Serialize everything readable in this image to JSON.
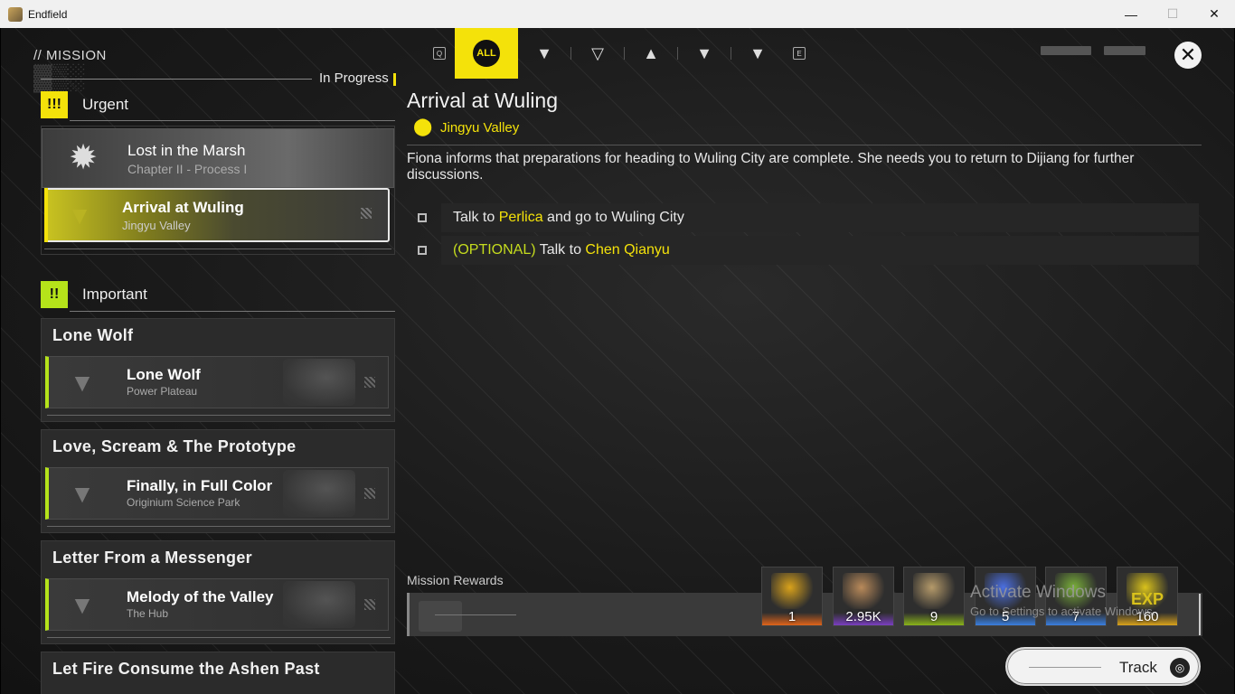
{
  "window": {
    "title": "Endfield",
    "controls": {
      "minimize": "—",
      "maximize": "☐",
      "close": "✕"
    }
  },
  "header": {
    "section_title": "// MISSION",
    "filter_keys": {
      "left": "Q",
      "right": "E"
    },
    "active_filter": "ALL",
    "close_glyph": "✕"
  },
  "filters": [
    {
      "name": "all",
      "label": "ALL",
      "active": true
    },
    {
      "name": "filter-1",
      "glyph": "▼"
    },
    {
      "name": "filter-2",
      "glyph": "▽"
    },
    {
      "name": "filter-3",
      "glyph": "▲"
    },
    {
      "name": "filter-4",
      "glyph": "▼"
    },
    {
      "name": "filter-5",
      "glyph": "▼"
    }
  ],
  "status_header": "In Progress",
  "sections": {
    "urgent": {
      "label": "Urgent",
      "icon_text": "!!!",
      "color": "#f4e20a"
    },
    "important": {
      "label": "Important",
      "icon_text": "!!",
      "color": "#b5e31a"
    }
  },
  "urgent_missions": {
    "featured": {
      "title": "Lost in the Marsh",
      "subtitle": "Chapter II - Process I"
    },
    "selected": {
      "name": "Arrival at Wuling",
      "location": "Jingyu Valley"
    }
  },
  "important_missions": [
    {
      "group": "Lone Wolf",
      "name": "Lone Wolf",
      "location": "Power Plateau"
    },
    {
      "group": "Love, Scream & The Prototype",
      "name": "Finally, in Full Color",
      "location": "Originium Science Park"
    },
    {
      "group": "Letter From a Messenger",
      "name": "Melody of the Valley",
      "location": "The Hub"
    },
    {
      "group": "Let Fire Consume the Ashen Past"
    }
  ],
  "detail": {
    "title": "Arrival at Wuling",
    "location": "Jingyu Valley",
    "description": "Fiona informs that preparations for heading to Wuling City are complete. She needs you to return to Dijiang for further discussions.",
    "objectives": [
      {
        "pre": "Talk to ",
        "hl": "Perlica",
        "post": " and go to Wuling City"
      },
      {
        "optional": "(OPTIONAL)",
        "pre": " Talk to ",
        "hl": "Chen Qianyu"
      }
    ]
  },
  "rewards": {
    "label": "Mission Rewards",
    "items": [
      {
        "name": "reward-gold-crystal",
        "count": "1",
        "icon_color": "#d9a21b",
        "stripe": "#e0641a"
      },
      {
        "name": "reward-currency",
        "count": "2.95K",
        "icon_color": "#b98a5a",
        "stripe": "#7a3fc0"
      },
      {
        "name": "reward-exp-book",
        "count": "9",
        "icon_color": "#b59a6a",
        "stripe": "#8ab31a"
      },
      {
        "name": "reward-blue-crystal",
        "count": "5",
        "icon_color": "#4b6fe0",
        "stripe": "#3a7fe0"
      },
      {
        "name": "reward-device",
        "count": "7",
        "icon_color": "#7ab03a",
        "stripe": "#3a7fe0"
      },
      {
        "name": "reward-exp",
        "count": "160",
        "icon_color": "#d9c21b",
        "stripe": "#d9a21b",
        "label": "EXP"
      }
    ]
  },
  "watermark": {
    "line1": "Activate Windows",
    "line2": "Go to Settings to activate Windows."
  },
  "track_button": {
    "label": "Track"
  }
}
